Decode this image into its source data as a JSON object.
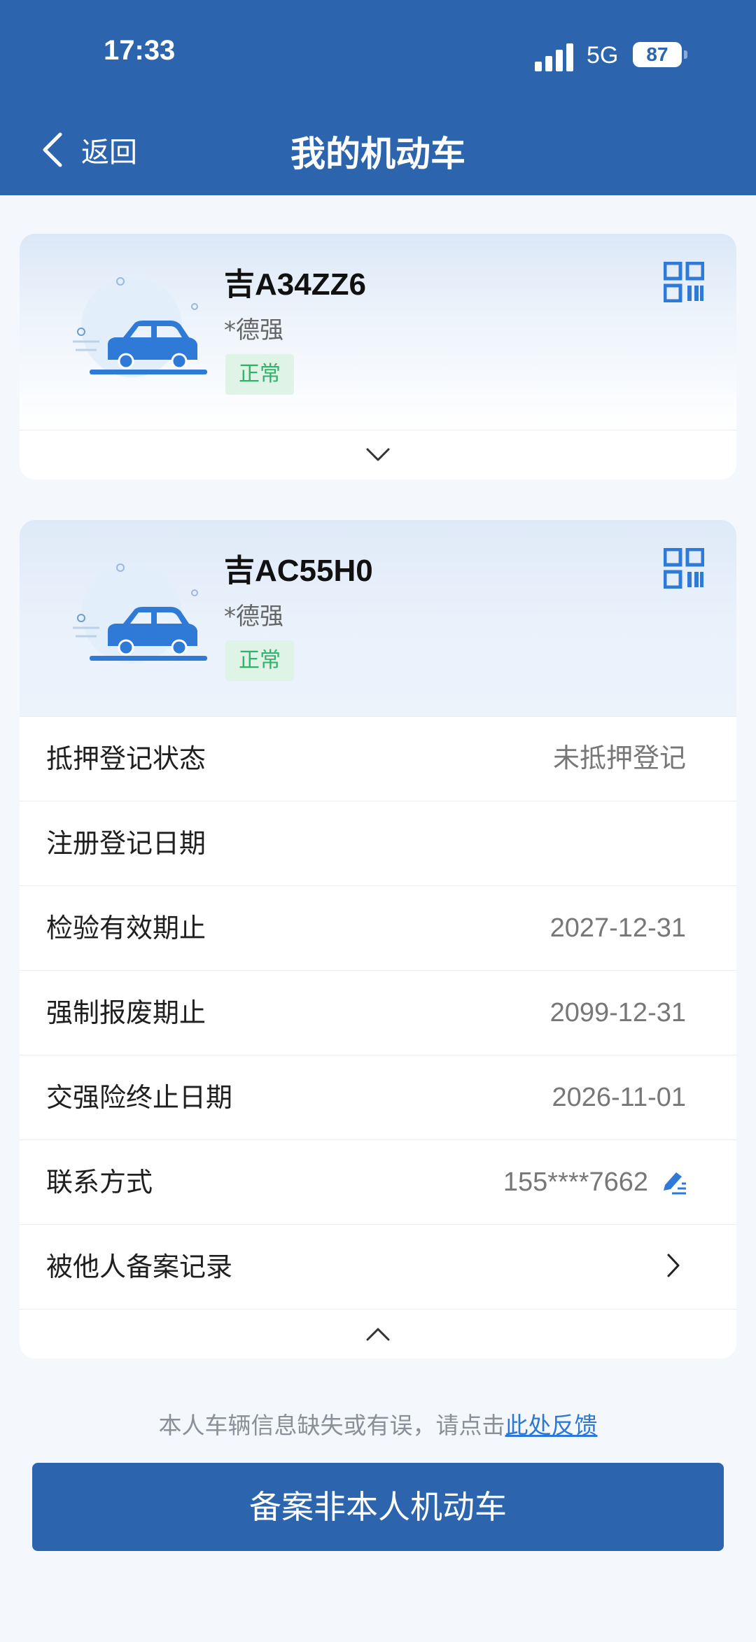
{
  "status_bar": {
    "time": "17:33",
    "network": "5G",
    "battery": "87"
  },
  "header": {
    "back_label": "返回",
    "title": "我的机动车"
  },
  "vehicles": [
    {
      "plate": "吉A34ZZ6",
      "owner": "*德强",
      "status": "正常"
    },
    {
      "plate": "吉AC55H0",
      "owner": "*德强",
      "status": "正常"
    }
  ],
  "details": [
    {
      "label": "抵押登记状态",
      "value": "未抵押登记"
    },
    {
      "label": "注册登记日期",
      "value": ""
    },
    {
      "label": "检验有效期止",
      "value": "2027-12-31"
    },
    {
      "label": "强制报废期止",
      "value": "2099-12-31"
    },
    {
      "label": "交强险终止日期",
      "value": "2026-11-01"
    },
    {
      "label": "联系方式",
      "value": "155****7662"
    },
    {
      "label": "被他人备案记录",
      "value": ""
    }
  ],
  "feedback": {
    "text": "本人车辆信息缺失或有误，请点击",
    "link": "此处反馈"
  },
  "primary_button": "备案非本人机动车",
  "colors": {
    "brand": "#2c65ae",
    "status_green": "#2fb26a",
    "link": "#2c78d4",
    "car_blue": "#2f7ad6"
  },
  "icons": [
    "back-chevron-icon",
    "car-icon",
    "qr-code-icon",
    "chevron-down-icon",
    "chevron-up-icon",
    "edit-icon",
    "chevron-right-icon"
  ]
}
